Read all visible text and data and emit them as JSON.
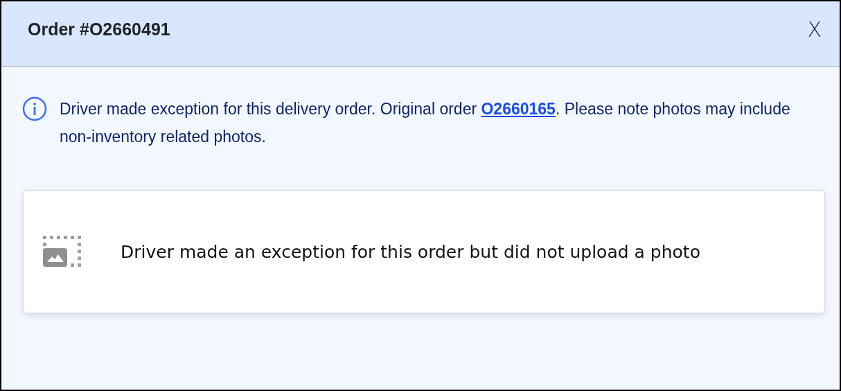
{
  "dialog": {
    "title": "Order #O2660491",
    "close": "X"
  },
  "notice": {
    "text_before": "Driver made exception for this delivery order. Original order ",
    "link": "O2660165",
    "text_after": ". Please note photos may include non-inventory related photos."
  },
  "photo_card": {
    "message": "Driver made an exception for this order but did not upload a photo"
  }
}
